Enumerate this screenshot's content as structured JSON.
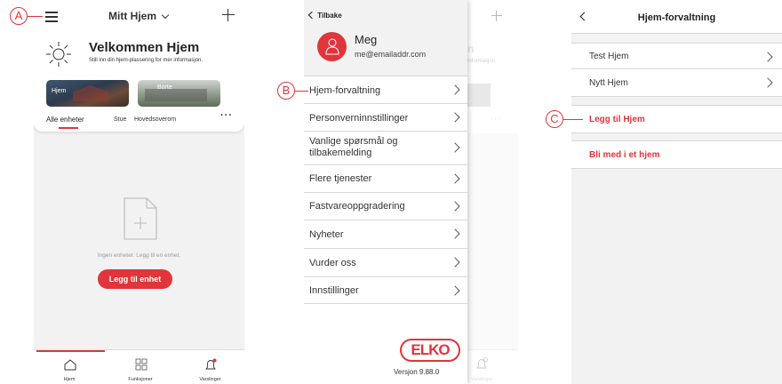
{
  "callouts": [
    "A",
    "B",
    "C"
  ],
  "screen1": {
    "home_title": "Mitt Hjem",
    "welcome_title": "Velkommen Hjem",
    "welcome_sub": "Still inn din hjem-plassering for mer informasjon.",
    "mode_cards": [
      "Hjem",
      "Borte"
    ],
    "room_tabs": [
      "Alle enheter",
      "Stue",
      "Hovedsoverom"
    ],
    "empty_text": "Ingen enheter. Legg til en enhet.",
    "add_device_label": "Legg til enhet",
    "bottom_nav": [
      "Hjem",
      "Funksjoner",
      "Varslinger"
    ]
  },
  "screen2": {
    "back_label": "Tilbake",
    "user_name": "Meg",
    "user_email": "me@emailaddr.com",
    "menu_items": [
      "Hjem-forvaltning",
      "Personverninnstillinger",
      "Vanlige spørsmål og tilbakemelding",
      "Flere tjenester",
      "Fastvareoppgradering",
      "Nyheter",
      "Vurder oss",
      "Innstillinger"
    ],
    "logo_text": "ELKO",
    "version": "Versjon 9.88.0",
    "bg_bottom_label": "Varslinger"
  },
  "screen3": {
    "title": "Hjem-forvaltning",
    "homes": [
      "Test Hjem",
      "Nytt Hjem"
    ],
    "add_home_label": "Legg til Hjem",
    "join_home_label": "Bli med i et hjem"
  },
  "colors": {
    "accent": "#e0353b",
    "background_grey": "#f2f2f2",
    "divider": "#d6d6d6"
  }
}
